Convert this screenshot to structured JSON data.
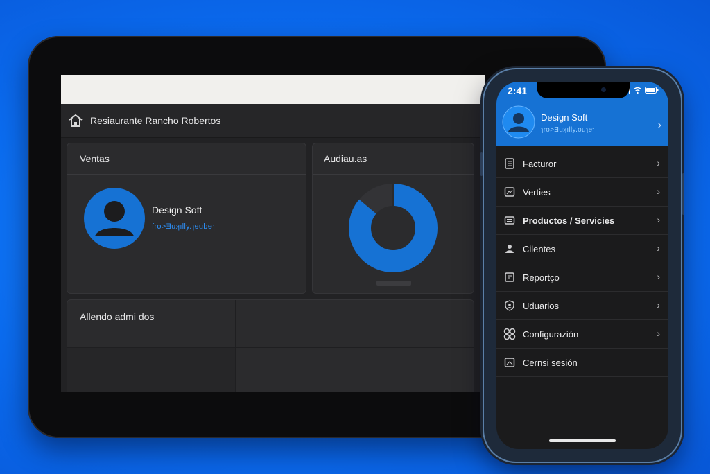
{
  "tablet": {
    "app_title": "Resiaurante Rancho Robertos",
    "cards": {
      "ventas": {
        "title": "Ventas",
        "user_name": "Design Soft",
        "user_sub": "fɾo>Ǝuʞılly.ɿɘubɘɿ"
      },
      "auditorias": {
        "title": "Audiau.as",
        "donut_fraction": 0.86
      },
      "pendientes": {
        "title": "Allendo admi dos"
      }
    }
  },
  "phone": {
    "time": "2:41",
    "profile": {
      "name": "Design Soft",
      "sub": "ɿro>Ǝuʞılly.ouɿeɿ"
    },
    "menu": [
      {
        "label": "Facturor",
        "icon": "invoice-icon",
        "chevron": true
      },
      {
        "label": "Verties",
        "icon": "sales-icon",
        "chevron": true
      },
      {
        "label": "Productos / Servicies",
        "icon": "box-icon",
        "chevron": true
      },
      {
        "label": "Cilentes",
        "icon": "person-icon",
        "chevron": true
      },
      {
        "label": "Reportço",
        "icon": "report-icon",
        "chevron": true
      },
      {
        "label": "Uduarios",
        "icon": "shield-user-icon",
        "chevron": true
      },
      {
        "label": "Configurazión",
        "icon": "gear-icon",
        "chevron": true
      },
      {
        "label": "Cernsi sesión",
        "icon": "logout-icon",
        "chevron": false
      }
    ]
  },
  "colors": {
    "background": "#0b6cf0",
    "accent": "#1672d4",
    "card": "#2b2b2d"
  }
}
